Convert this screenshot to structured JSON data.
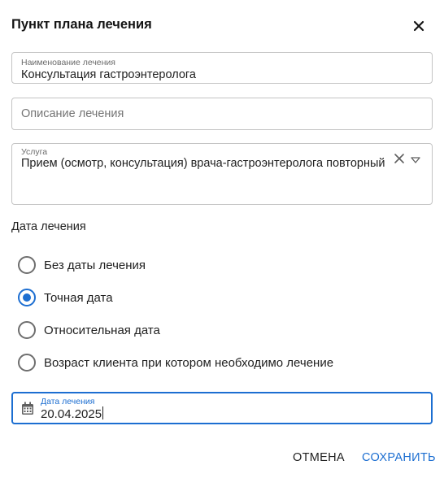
{
  "dialog": {
    "title": "Пункт плана лечения"
  },
  "fields": {
    "name": {
      "label": "Наименование лечения",
      "value": "Консультация гастроэнтеролога"
    },
    "description": {
      "placeholder": "Описание лечения",
      "value": ""
    },
    "service": {
      "label": "Услуга",
      "value": "Прием (осмотр, консультация) врача-гастроэнтеролога повторный"
    }
  },
  "date_section": {
    "title": "Дата лечения",
    "options": [
      {
        "label": "Без даты лечения",
        "selected": false
      },
      {
        "label": "Точная дата",
        "selected": true
      },
      {
        "label": "Относительная дата",
        "selected": false
      },
      {
        "label": "Возраст клиента при котором необходимо лечение",
        "selected": false
      }
    ]
  },
  "date_field": {
    "label": "Дата лечения",
    "value": "20.04.2025"
  },
  "actions": {
    "cancel": "ОТМЕНА",
    "save": "СОХРАНИТЬ"
  },
  "colors": {
    "accent": "#1c6ed1",
    "border": "#c4c4c4",
    "text": "#1f1f1f"
  },
  "icons": {
    "close": "close-icon",
    "clear": "clear-icon",
    "dropdown": "dropdown-arrow-icon",
    "calendar": "calendar-icon"
  }
}
